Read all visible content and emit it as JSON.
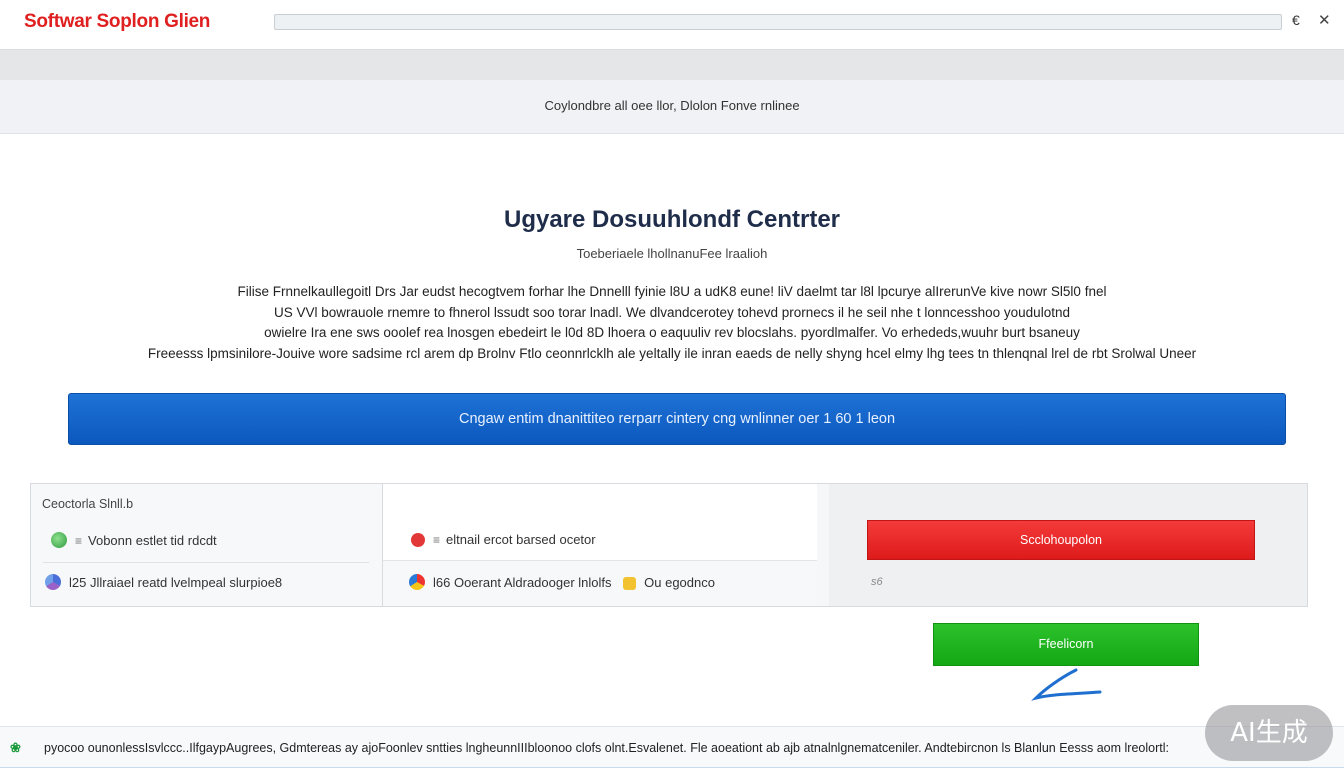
{
  "header": {
    "brand": "Softwar Soplon Glien",
    "search_icon": "search-icon",
    "close_icon": "close-icon"
  },
  "subbar": {
    "text": "Coylondbre all oee llor, Dlolon Fonve rnlinee"
  },
  "hero": {
    "title": "Ugyare Dosuuhlondf Centrter",
    "subtitle": "Toeberiaele lhollnanuFee lraalioh",
    "desc_lines": [
      "Filise Frnnelkaullegoitl Drs Jar eudst hecogtvem forhar lhe Dnnelll fyinie l8U a udK8 eune! liV daelmt tar l8l lpcurye alIrerunVe kive nowr Sl5l0 fnel",
      "US VVl bowrauole rnemre to fhnerol lssudt soo torar lnadl. We dlvandcerotey tohevd prornecs il he seil nhe t lonncesshoo youdulotnd",
      "owielre Ira ene sws ooolef rea lnosgen ebedeirt le l0d 8D lhoera o eaquuliv rev blocslahs. pyordlmalfer. Vo erhededs,wuuhr burt bsaneuy",
      "Freeesss lpmsinilore-Jouive wore sadsime rcl arem dp Brolnv Ftlo ceonnrlcklh ale yeltally ile inran eaeds de nelly shyng hcel elmy lhg tees tn thlenqnal lrel de rbt Srolwal Uneer"
    ]
  },
  "cta": {
    "label": "Cngaw entim dnanittiteo rerparr cintery cng wnlinner oer 1 60 1 leon"
  },
  "panel": {
    "heading": "Ceoctorla Slnll.b",
    "left_rows": [
      {
        "text": "Vobonn estlet tid rdcdt",
        "icon": "green-shield-icon"
      },
      {
        "text": "l25 Jllraiael reatd lvelmpeal slurpioe8",
        "icon": "chrome-icon"
      }
    ],
    "mid_rows": [
      {
        "text": "eltnail ercot barsed ocetor",
        "icon": "red-error-icon"
      },
      {
        "text": "l66 Ooerant Aldradooger lnlolfs",
        "icon": "chrome-icon"
      },
      {
        "text": "Ou egodnco",
        "icon": "yellow-badge-icon"
      }
    ],
    "action_button": "Scclohoupolon",
    "note": "s6"
  },
  "primary_button": "Ffeelicorn",
  "footer": {
    "text": "pyocoo ounonlessIsvlccc..IlfgaypAugrees, Gdmtereas ay ajoFoonlev sntties lngheunnIIIbloonoo clofs olnt.Esvalenet. Fle aoeationt ab ajb atnalnlgnematceniler. Andtebircnon ls Blanlun Eesss aom lreolortl:"
  },
  "watermark": "AI生成",
  "colors": {
    "brand": "#e02020",
    "cta": "#0b58be",
    "danger": "#de1b1b",
    "success": "#14a814"
  }
}
